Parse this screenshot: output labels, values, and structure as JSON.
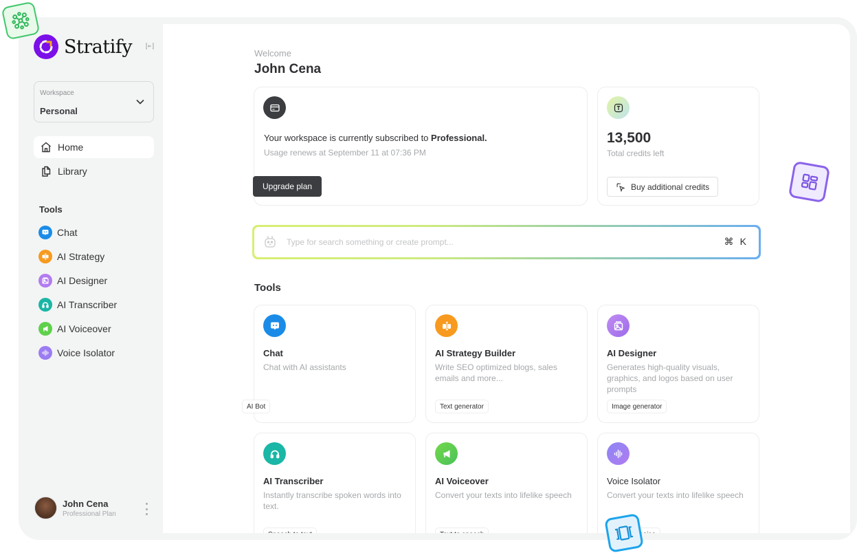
{
  "brand": {
    "name": "Stratify"
  },
  "sidebar": {
    "workspace": {
      "label": "Workspace",
      "value": "Personal"
    },
    "nav": [
      {
        "label": "Home",
        "icon": "home-icon",
        "active": true
      },
      {
        "label": "Library",
        "icon": "copy-icon",
        "active": false
      }
    ],
    "tools_title": "Tools",
    "tools": [
      {
        "label": "Chat",
        "icon": "chat-icon",
        "color": "#1a8ce8"
      },
      {
        "label": "AI Strategy",
        "icon": "text-cursor-icon",
        "color": "#f79a1f"
      },
      {
        "label": "AI Designer",
        "icon": "image-icon",
        "color": "#b27cf0"
      },
      {
        "label": "AI Transcriber",
        "icon": "headphones-icon",
        "color": "#1ab6a6"
      },
      {
        "label": "AI Voiceover",
        "icon": "megaphone-icon",
        "color": "#5fd04c"
      },
      {
        "label": "Voice Isolator",
        "icon": "waveform-icon",
        "color": "#9b7cf2"
      }
    ],
    "user": {
      "name": "John Cena",
      "plan": "Professional Plan"
    }
  },
  "main": {
    "welcome": "Welcome",
    "username": "John Cena",
    "subscription": {
      "text_prefix": "Your workspace is currently subscribed to ",
      "plan": "Professional.",
      "renews": "Usage renews at September 11 at 07:36 PM",
      "upgrade_label": "Upgrade plan"
    },
    "credits": {
      "value": "13,500",
      "label": "Total credits left",
      "buy_label": "Buy additional credits"
    },
    "search": {
      "placeholder": "Type for search something or create prompt...",
      "value": "",
      "shortcut_symbol": "⌘",
      "shortcut_key": "K"
    },
    "tools_title": "Tools",
    "tool_cards": [
      {
        "title": "Chat",
        "desc": "Chat with AI assistants",
        "tag": "AI Bot",
        "color": "#1a8ce8"
      },
      {
        "title": "AI Strategy Builder",
        "desc": "Write SEO optimized blogs, sales emails and more...",
        "tag": "Text generator",
        "color": "#f79a1f"
      },
      {
        "title": "AI Designer",
        "desc": "Generates high-quality visuals, graphics, and logos based on user prompts",
        "tag": "Image generator",
        "color": "#b27cf0"
      },
      {
        "title": "AI Transcriber",
        "desc": "Instantly transcribe spoken words into text.",
        "tag": "Speech to text",
        "color": "#1ab6a6"
      },
      {
        "title": "AI Voiceover",
        "desc": "Convert your texts into lifelike speech",
        "tag": "Text to speech",
        "color": "#5fd04c"
      },
      {
        "title": "Voice Isolator",
        "desc": "Convert your texts into lifelike speech",
        "tag": "Remove noise",
        "color": "#9b7cf2"
      }
    ]
  },
  "colors": {
    "brand": "#7b10e8",
    "accent_orange": "#f5a623",
    "frame_bg": "#f3f4f4",
    "dark_button": "#3b3d40"
  }
}
